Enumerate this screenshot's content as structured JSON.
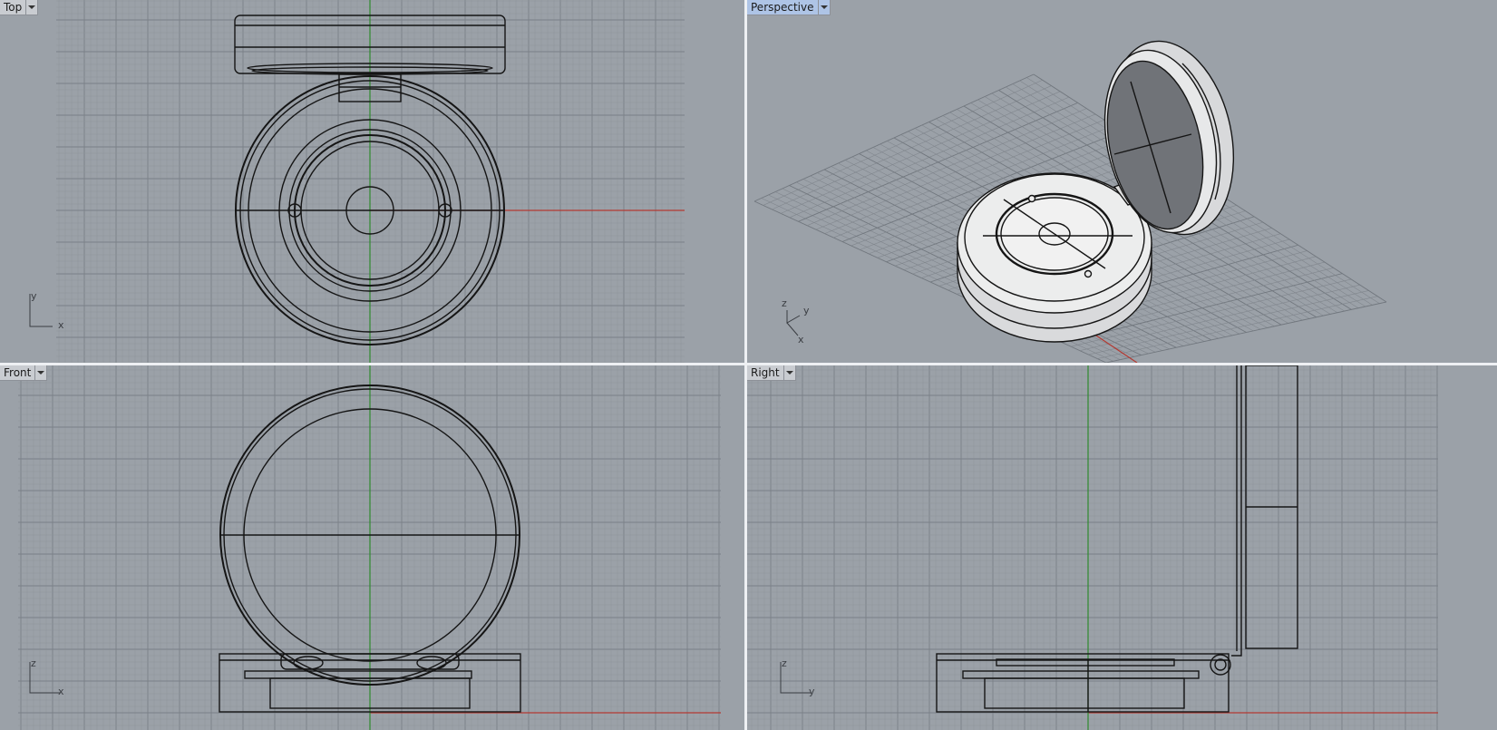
{
  "viewports": {
    "top": {
      "label": "Top",
      "axes": [
        "y",
        "x"
      ],
      "active": false
    },
    "persp": {
      "label": "Perspective",
      "axes": [
        "z",
        "y",
        "x"
      ],
      "active": true
    },
    "front": {
      "label": "Front",
      "axes": [
        "z",
        "x"
      ],
      "active": false
    },
    "right": {
      "label": "Right",
      "axes": [
        "z",
        "y"
      ],
      "active": false
    }
  },
  "icons": {
    "viewport_menu": "chevron-down-icon"
  },
  "colors": {
    "viewport_bg": "#9ba1a8",
    "grid_minor": "#8e949b",
    "grid_major": "#7a8087",
    "x_axis": "#b33a32",
    "y_axis": "#2e8a2e",
    "wire": "#151515",
    "active_label": "#aec4e6"
  }
}
